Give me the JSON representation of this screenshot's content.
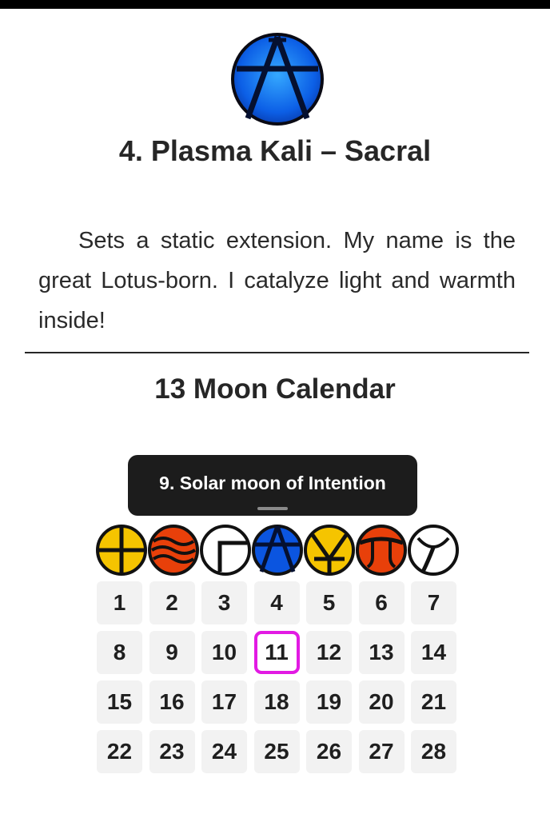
{
  "hero": {
    "icon": "plasma-kali-glyph-icon",
    "title": "4. Plasma Kali – Sacral",
    "description": "Sets a static extension. My name is the great Lotus-born. I catalyze light and warmth inside!"
  },
  "calendar": {
    "title": "13 Moon Calendar",
    "moon_label": "9. Solar moon of Intention",
    "selected_day": 11,
    "selected_color": "#e21ae3",
    "plasma_glyphs": [
      {
        "name": "dali-glyph-icon",
        "color": "#f5c400"
      },
      {
        "name": "seli-glyph-icon",
        "color": "#e8400a"
      },
      {
        "name": "gamma-glyph-icon",
        "color": "#ffffff"
      },
      {
        "name": "kali-glyph-icon",
        "color": "#0b55e0"
      },
      {
        "name": "alpha-glyph-icon",
        "color": "#f5c400"
      },
      {
        "name": "limi-glyph-icon",
        "color": "#e8400a"
      },
      {
        "name": "silio-glyph-icon",
        "color": "#ffffff"
      }
    ],
    "days": [
      "1",
      "2",
      "3",
      "4",
      "5",
      "6",
      "7",
      "8",
      "9",
      "10",
      "11",
      "12",
      "13",
      "14",
      "15",
      "16",
      "17",
      "18",
      "19",
      "20",
      "21",
      "22",
      "23",
      "24",
      "25",
      "26",
      "27",
      "28"
    ]
  }
}
